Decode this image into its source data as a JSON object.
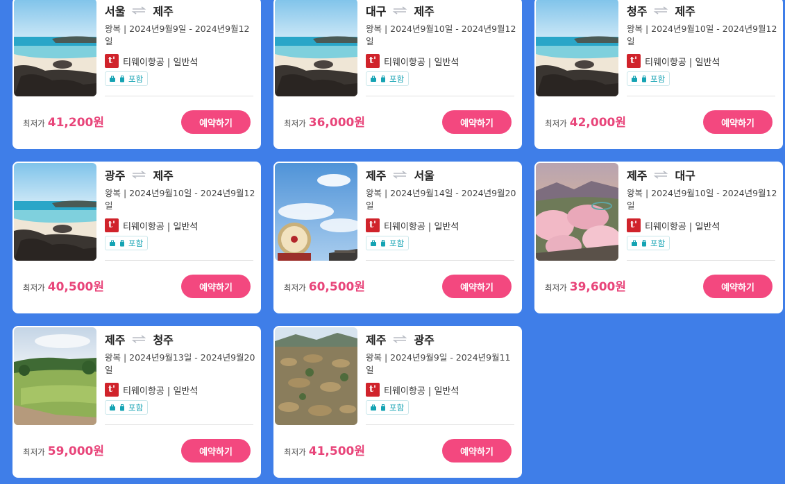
{
  "cards": [
    {
      "origin": "서울",
      "destination": "제주",
      "dates": "왕복 | 2024년9월9일 - 2024년9월12일",
      "airline": "티웨이항공 | 일반석",
      "baggage": "포함",
      "price_label": "최저가",
      "price": "41,200원",
      "button": "예약하기",
      "image": "beach"
    },
    {
      "origin": "대구",
      "destination": "제주",
      "dates": "왕복 | 2024년9월10일 - 2024년9월12일",
      "airline": "티웨이항공 | 일반석",
      "baggage": "포함",
      "price_label": "최저가",
      "price": "36,000원",
      "button": "예약하기",
      "image": "beach"
    },
    {
      "origin": "청주",
      "destination": "제주",
      "dates": "왕복 | 2024년9월10일 - 2024년9월12일",
      "airline": "티웨이항공 | 일반석",
      "baggage": "포함",
      "price_label": "최저가",
      "price": "42,000원",
      "button": "예약하기",
      "image": "beach"
    },
    {
      "origin": "광주",
      "destination": "제주",
      "dates": "왕복 | 2024년9월10일 - 2024년9월12일",
      "airline": "티웨이항공 | 일반석",
      "baggage": "포함",
      "price_label": "최저가",
      "price": "40,500원",
      "button": "예약하기",
      "image": "beach"
    },
    {
      "origin": "제주",
      "destination": "서울",
      "dates": "왕복 | 2024년9월14일 - 2024년9월20일",
      "airline": "티웨이항공 | 일반석",
      "baggage": "포함",
      "price_label": "최저가",
      "price": "60,500원",
      "button": "예약하기",
      "image": "sky"
    },
    {
      "origin": "제주",
      "destination": "대구",
      "dates": "왕복 | 2024년9월10일 - 2024년9월12일",
      "airline": "티웨이항공 | 일반석",
      "baggage": "포함",
      "price_label": "최저가",
      "price": "39,600원",
      "button": "예약하기",
      "image": "blossom"
    },
    {
      "origin": "제주",
      "destination": "청주",
      "dates": "왕복 | 2024년9월13일 - 2024년9월20일",
      "airline": "티웨이항공 | 일반석",
      "baggage": "포함",
      "price_label": "최저가",
      "price": "59,000원",
      "button": "예약하기",
      "image": "field"
    },
    {
      "origin": "제주",
      "destination": "광주",
      "dates": "왕복 | 2024년9월9일 - 2024년9월11일",
      "airline": "티웨이항공 | 일반석",
      "baggage": "포함",
      "price_label": "최저가",
      "price": "41,500원",
      "button": "예약하기",
      "image": "village"
    }
  ],
  "airline_logo_letter": "t'",
  "colors": {
    "background": "#3f7ee8",
    "accent": "#f3487f",
    "price": "#e8457a",
    "baggage": "#14a3b3",
    "logo": "#d0232b"
  }
}
